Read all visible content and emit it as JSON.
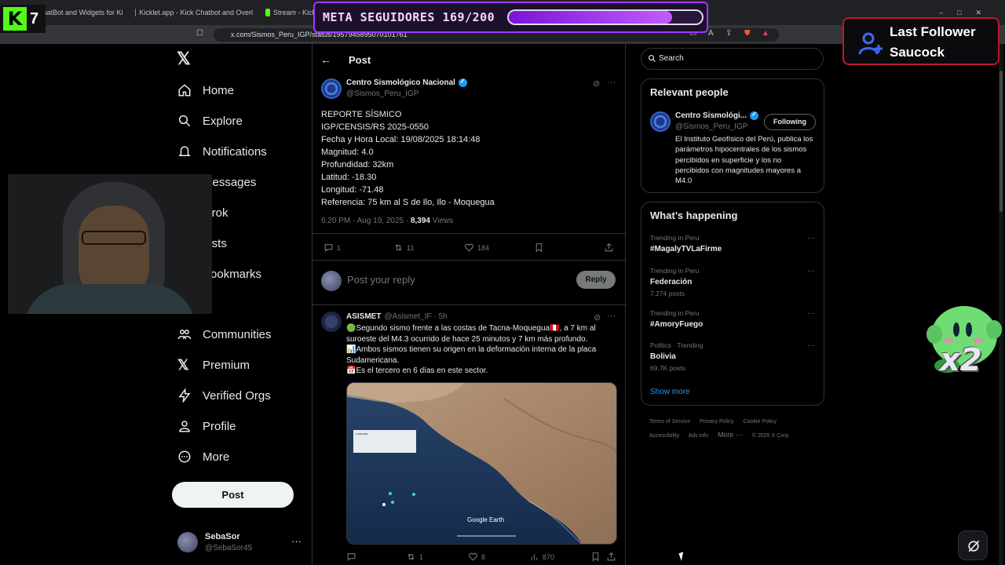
{
  "browser": {
    "tabs": [
      "ChatBot and Widgets for Ki",
      "Kicklet.app - Kick Chatbot and Overl",
      "Stream - Kick"
    ],
    "url": "x.com/Sismos_Peru_IGP/status/1957945895070101761"
  },
  "overlay": {
    "kick_count": "7",
    "meta_label": "META SEGUIDORES 169/200",
    "meta_progress": 0.845,
    "last_follower_title": "Last Follower",
    "last_follower_name": "Saucock",
    "multiplier": "x2"
  },
  "nav": {
    "items": [
      "Home",
      "Explore",
      "Notifications",
      "Messages",
      "Grok",
      "Lists",
      "Bookmarks",
      "Communities",
      "Premium",
      "Verified Orgs",
      "Profile",
      "More"
    ],
    "post_label": "Post",
    "account": {
      "name": "SebaSor",
      "handle": "@SebaSor45"
    }
  },
  "main": {
    "header": "Post",
    "tweet": {
      "name": "Centro Sismológico Nacional",
      "handle": "@Sismos_Peru_IGP",
      "body": "REPORTE SÍSMICO\nIGP/CENSIS/RS 2025-0550\nFecha y Hora Local: 19/08/2025 18:14:48\nMagnitud: 4.0\nProfundidad: 32km\nLatitud: -18.30\nLongitud: -71.48\nReferencia: 75 km al S de Ilo, Ilo - Moquegua",
      "time": "6:20 PM · Aug 19, 2025 · ",
      "views_count": "8,394",
      "views_label": " Views",
      "replies": "1",
      "retweets": "11",
      "likes": "184"
    },
    "reply_placeholder": "Post your reply",
    "reply_button": "Reply",
    "tweet2": {
      "name": "ASISMET",
      "handle": "@Asismet_IF · 5h",
      "line1": "🟢Segundo sismo frente a las costas de Tacna-Moquegua🇵🇪, a 7 km al suroeste del M4.3 ocurrido de hace 25 minutos y 7 km más profundo.",
      "line2": "📊Ambos sismos tienen su origen en la deformación interna de la placa Sudamericana.",
      "line3": "📅Es el tercero en 6 días en este sector.",
      "map_label": "Google Earth",
      "map_legend": "Leyenda",
      "replies": "",
      "retweets": "1",
      "likes": "8",
      "views": "870"
    }
  },
  "right": {
    "search_placeholder": "Search",
    "relevant_title": "Relevant people",
    "person": {
      "name": "Centro Sismológi...",
      "handle": "@Sismos_Peru_IGP",
      "follow_label": "Following",
      "bio": "El Instituto Geofísico del Perú, publica los parámetros hipocentrales de los sismos percibidos en superficie y los no percibidos con magnitudes mayores a M4.0"
    },
    "happening_title": "What’s happening",
    "trends": [
      {
        "context": "Trending in Peru",
        "title": "#MagalyTVLaFirme",
        "count": ""
      },
      {
        "context": "Trending in Peru",
        "title": "Federación",
        "count": "7,274 posts"
      },
      {
        "context": "Trending in Peru",
        "title": "#AmoryFuego",
        "count": ""
      },
      {
        "context": "Politics · Trending",
        "title": "Bolivia",
        "count": "69.7K posts"
      }
    ],
    "show_more": "Show more",
    "footer": [
      "Terms of Service",
      "Privacy Policy",
      "Cookie Policy",
      "Accessibility",
      "Ads info",
      "More ···",
      "© 2025 X Corp."
    ]
  }
}
